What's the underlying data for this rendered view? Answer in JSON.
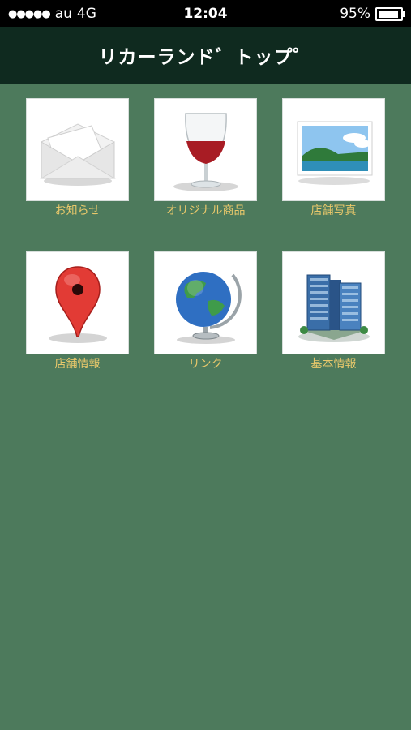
{
  "status": {
    "carrier": "au",
    "network": "4G",
    "time": "12:04",
    "battery": "95%"
  },
  "nav": {
    "title": "リカーランド゛トップ゜"
  },
  "tiles": [
    {
      "label": "お知らせ",
      "icon": "envelope-icon"
    },
    {
      "label": "オリジナル商品",
      "icon": "wine-glass-icon"
    },
    {
      "label": "店舗写真",
      "icon": "landscape-photo-icon"
    },
    {
      "label": "店舗情報",
      "icon": "map-pin-icon"
    },
    {
      "label": "リンク",
      "icon": "globe-icon"
    },
    {
      "label": "基本情報",
      "icon": "office-building-icon"
    }
  ],
  "colors": {
    "background": "#4d7a5c",
    "navbar": "#0f2a1f",
    "label": "#e9c86b"
  }
}
